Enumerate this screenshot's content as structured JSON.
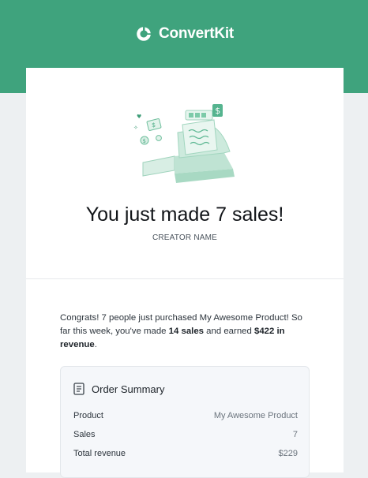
{
  "header": {
    "brand_name": "ConvertKit",
    "brand_color": "#3fa37d"
  },
  "hero": {
    "illustration": "cash-register-illustration",
    "headline": "You just made 7 sales!",
    "creator": "CREATOR NAME"
  },
  "message": {
    "part1": "Congrats! 7 people just purchased My Awesome Product! So far this week, you've made ",
    "sales_bold": "14 sales",
    "part2": " and earned ",
    "revenue_bold": "$422 in revenue",
    "part3": "."
  },
  "order_summary": {
    "icon": "document-icon",
    "title": "Order Summary",
    "rows": [
      {
        "label": "Product",
        "value": "My Awesome Product"
      },
      {
        "label": "Sales",
        "value": "7"
      },
      {
        "label": "Total revenue",
        "value": "$229"
      }
    ]
  }
}
